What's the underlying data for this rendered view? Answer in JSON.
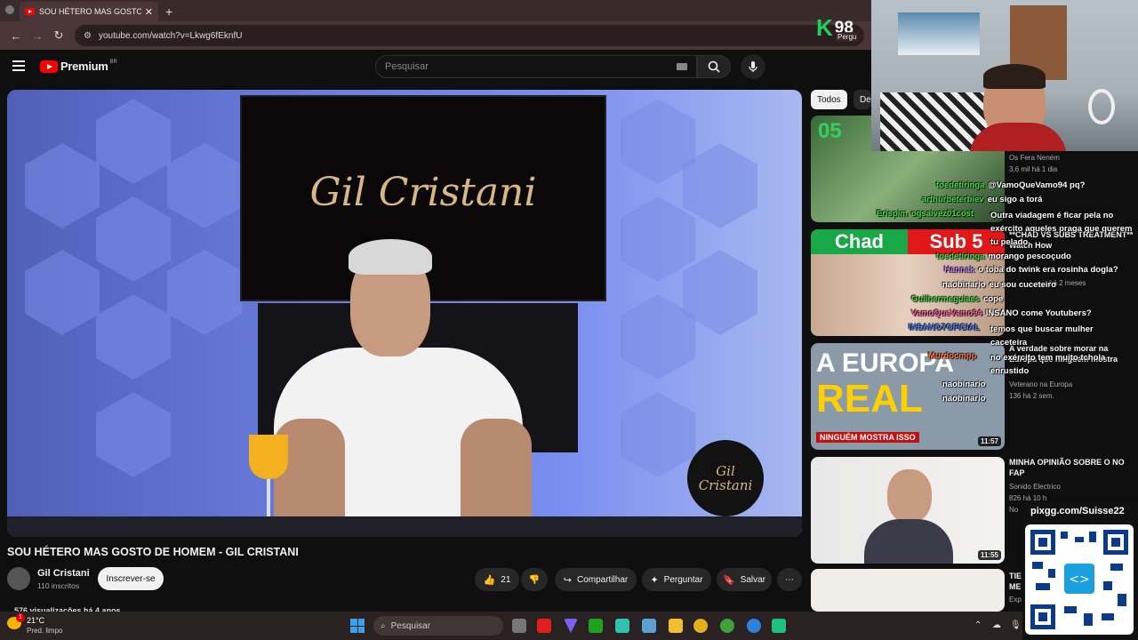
{
  "browser": {
    "tab_title": "SOU HÉTERO MAS GOSTO DE H",
    "tab_close": "✕",
    "new_tab": "+",
    "back": "←",
    "forward": "→",
    "reload": "↻",
    "url": "youtube.com/watch?v=Lkwg6fEknfU"
  },
  "youtube": {
    "brand": "Premium",
    "region": "BR",
    "search_placeholder": "Pesquisar",
    "brand_color": "#ff0000"
  },
  "video": {
    "tv_text": "Gil Cristani",
    "watermark": "Gil Cristani",
    "title": "SOU HÉTERO MAS GOSTO DE HOMEM - GIL CRISTANI",
    "channel": "Gil Cristani",
    "subscribers": "110 inscritos",
    "subscribe_label": "Inscrever-se",
    "likes": "21",
    "share_label": "Compartilhar",
    "ask_label": "Perguntar",
    "save_label": "Salvar",
    "more_label": "⋯",
    "views": "576 visualizações  há 4 anos"
  },
  "sidebar": {
    "chips": [
      "Todos",
      "De"
    ],
    "items": [
      {
        "title": "",
        "channel": "Os Fera Neném",
        "meta": "3,6 mil  há 1 dia",
        "duration": "",
        "thumb_text": "05"
      },
      {
        "title": "**CHAD VS SUBS TREATMENT** Watch How",
        "channel": "",
        "meta": "há 2 meses",
        "duration": "",
        "thumb_text_a": "Chad",
        "thumb_text_b": "Sub 5"
      },
      {
        "title": "A verdade sobre morar na Europa que ninguém mostra",
        "channel": "Veterano na Europa",
        "meta": "136  há 2 sem.",
        "duration": "11:57",
        "thumb_text_a": "A EUROPA",
        "thumb_text_b": "REAL",
        "thumb_text_c": "NINGUÉM MOSTRA ISSO"
      },
      {
        "title": "MINHA OPINIÃO SOBRE O NO FAP",
        "channel": "Sonido Electrico",
        "meta": "826  há 10 h",
        "duration": "11:55"
      },
      {
        "title": "TIE ME",
        "channel": "Exp",
        "meta": "",
        "duration": ""
      }
    ],
    "extra_meta": "No"
  },
  "stream": {
    "k_label": "K",
    "k_value": "98",
    "pergu": "Pergu",
    "chat": [
      {
        "user": "toedetiringa",
        "user_color": "#40e040",
        "msg": "@VamoQueVamo94 pq?"
      },
      {
        "user": "arthurbeterbiev",
        "user_color": "#40e040",
        "msg": "eu sigo a torá"
      },
      {
        "user": "Erispim",
        "user_color": "#40e040",
        "user2": "ogsalvez01cost",
        "msg": "Outra viadagem é ficar pela no exército aqueles praga que querem tu pelado"
      },
      {
        "user": "toedetiringa",
        "user_color": "#40e040",
        "msg": "morango pescoçudo"
      },
      {
        "user": "Hannak",
        "user_color": "#c080ff",
        "msg": "o toba do twink era rosinha dogla?"
      },
      {
        "user": "naobinario",
        "user_color": "#ffffff",
        "msg": "eu sou cuceteiro"
      },
      {
        "user": "Guilhermeguiaes",
        "user_color": "#40e040",
        "msg": "cope"
      },
      {
        "user": "VamoQueVamo94",
        "user_color": "#ff60a0",
        "msg": "INSANO come Youtubers?"
      },
      {
        "user": "INSANO7OFICIAL",
        "user_color": "#4080ff",
        "msg": "temos que buscar mulher caceteira"
      },
      {
        "user": "Murdocmpp",
        "user_color": "#ff7040",
        "msg": "no exército tem muito tchola enrustido"
      },
      {
        "user": "naobinario",
        "user_color": "#ffffff",
        "msg": ""
      },
      {
        "user": "naobinario",
        "user_color": "#ffffff",
        "msg": ""
      }
    ],
    "qr_label": "pixgg.com/Suisse22"
  },
  "taskbar": {
    "badge": "1",
    "temperature": "21°C",
    "condition": "Pred. limpo",
    "search_placeholder": "Pesquisar"
  }
}
